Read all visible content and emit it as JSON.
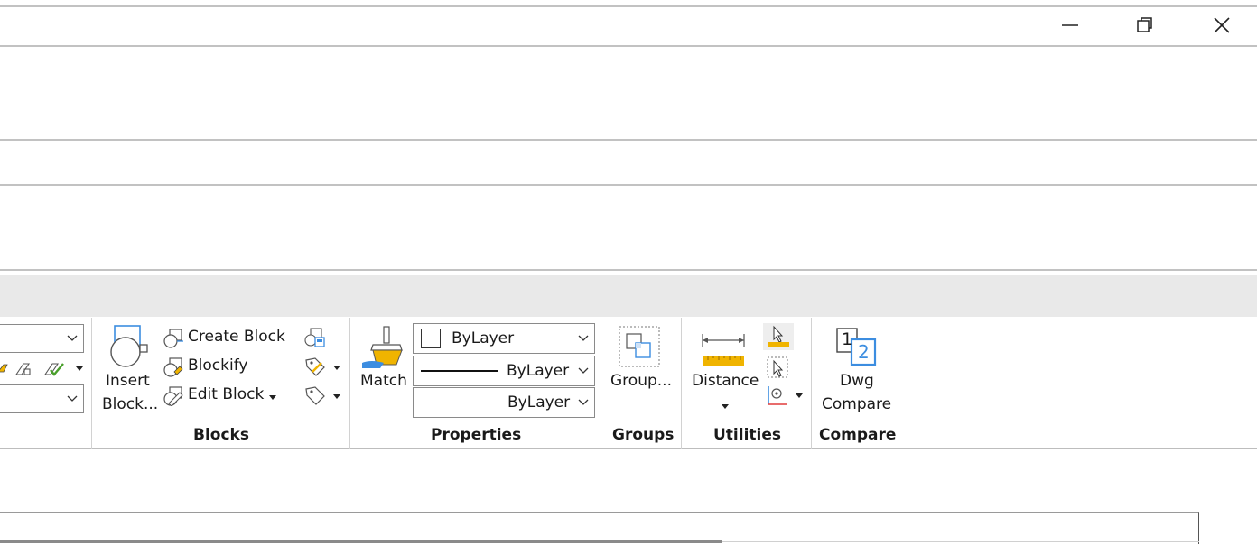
{
  "window": {
    "minimize_icon": "minimize-icon",
    "restore_icon": "restore-icon",
    "close_icon": "close-icon"
  },
  "ribbon": {
    "blocks": {
      "title": "Blocks",
      "insert_line1": "Insert",
      "insert_line2": "Block...",
      "create_block": "Create Block",
      "blockify": "Blockify",
      "edit_block": "Edit Block"
    },
    "properties": {
      "title": "Properties",
      "match": "Match",
      "color_value": "ByLayer",
      "linetype_value": "ByLayer",
      "lineweight_value": "ByLayer"
    },
    "groups": {
      "title": "Groups",
      "group": "Group..."
    },
    "utilities": {
      "title": "Utilities",
      "distance": "Distance"
    },
    "compare": {
      "title": "Compare",
      "dwg_line1": "Dwg",
      "dwg_line2": "Compare",
      "icon_num1": "1",
      "icon_num2": "2"
    }
  },
  "colors": {
    "accent_blue": "#3c8de0",
    "ruler_yellow": "#f0b400",
    "divider": "#c2c2c2",
    "ribbon_header": "#e9e9e9"
  }
}
